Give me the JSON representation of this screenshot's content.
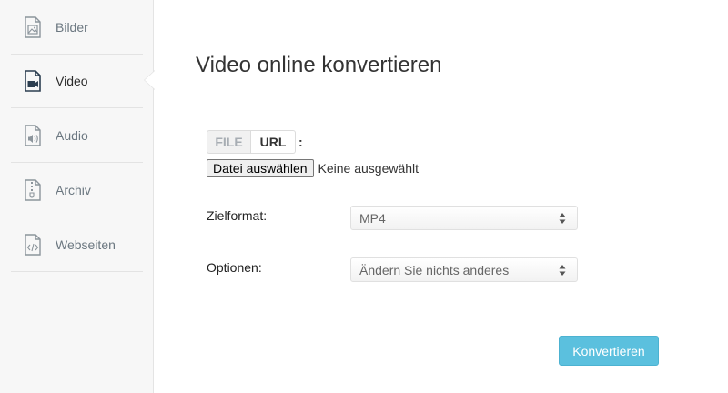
{
  "sidebar": {
    "items": [
      {
        "label": "Bilder",
        "icon": "image-file-icon",
        "active": false
      },
      {
        "label": "Video",
        "icon": "video-file-icon",
        "active": true
      },
      {
        "label": "Audio",
        "icon": "audio-file-icon",
        "active": false
      },
      {
        "label": "Archiv",
        "icon": "archive-file-icon",
        "active": false
      },
      {
        "label": "Webseiten",
        "icon": "code-file-icon",
        "active": false
      }
    ]
  },
  "main": {
    "title": "Video online konvertieren",
    "source_tabs": {
      "file": "FILE",
      "url": "URL",
      "colon": ":"
    },
    "file_input": {
      "button_label": "Datei auswählen",
      "status": "Keine ausgewählt"
    },
    "target_format": {
      "label": "Zielformat:",
      "value": "MP4"
    },
    "options": {
      "label": "Optionen:",
      "value": "Ändern Sie nichts anderes"
    },
    "convert_label": "Konvertieren"
  },
  "colors": {
    "accent": "#5bc0de",
    "sidebar_bg": "#f7f7f7",
    "muted_text": "#6b7780"
  }
}
